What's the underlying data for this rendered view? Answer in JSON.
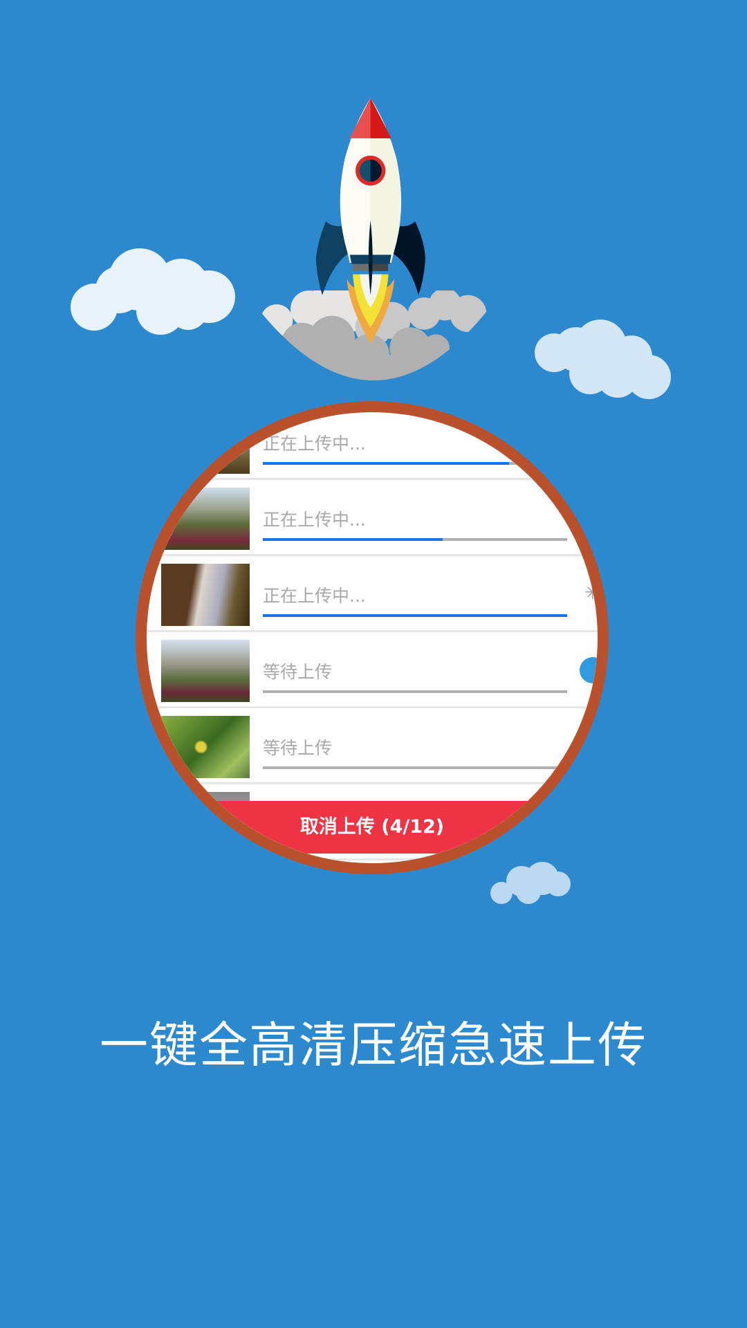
{
  "upload_list": {
    "items": [
      {
        "status": "正在上传中...",
        "progress": 0.81
      },
      {
        "status": "正在上传中...",
        "progress": 0.59
      },
      {
        "status": "正在上传中...",
        "progress": 1.0
      },
      {
        "status": "等待上传",
        "progress": 0
      },
      {
        "status": "等待上传",
        "progress": 0
      }
    ],
    "cancel_label": "取消上传 (4/12)"
  },
  "tagline": "一键全高清压缩急速上传",
  "colors": {
    "background": "#2d89cd",
    "ring": "#b9522c",
    "cancel": "#ee3344",
    "progress": "#1a73e8"
  }
}
